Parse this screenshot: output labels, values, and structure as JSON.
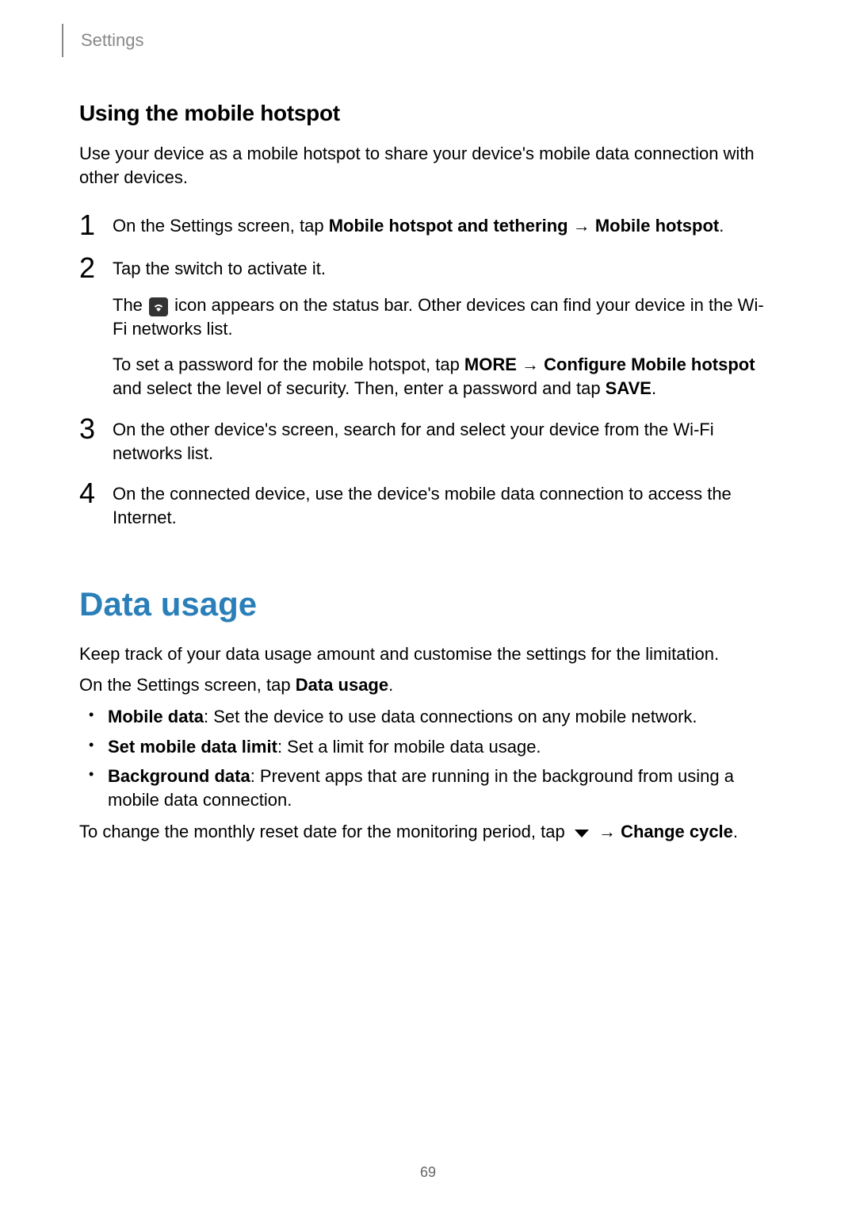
{
  "header": {
    "breadcrumb": "Settings"
  },
  "hotspot_section": {
    "subtitle": "Using the mobile hotspot",
    "intro": "Use your device as a mobile hotspot to share your device's mobile data connection with other devices.",
    "steps": {
      "s1": {
        "num": "1",
        "text_a": "On the Settings screen, tap ",
        "bold_a": "Mobile hotspot and tethering",
        "arrow": " → ",
        "bold_b": "Mobile hotspot",
        "text_end": "."
      },
      "s2": {
        "num": "2",
        "p1": "Tap the switch to activate it.",
        "p2_a": "The ",
        "p2_b": " icon appears on the status bar. Other devices can find your device in the Wi-Fi networks list.",
        "p3_a": "To set a password for the mobile hotspot, tap ",
        "p3_bold_a": "MORE",
        "p3_arr1": " → ",
        "p3_bold_b": "Configure Mobile hotspot",
        "p3_b": " and select the level of security. Then, enter a password and tap ",
        "p3_bold_c": "SAVE",
        "p3_end": "."
      },
      "s3": {
        "num": "3",
        "text": "On the other device's screen, search for and select your device from the Wi-Fi networks list."
      },
      "s4": {
        "num": "4",
        "text": "On the connected device, use the device's mobile data connection to access the Internet."
      }
    }
  },
  "data_usage_section": {
    "title": "Data usage",
    "intro": "Keep track of your data usage amount and customise the settings for the limitation.",
    "instruction_a": "On the Settings screen, tap ",
    "instruction_bold": "Data usage",
    "instruction_end": ".",
    "bullets": {
      "b1": {
        "bold": "Mobile data",
        "text": ": Set the device to use data connections on any mobile network."
      },
      "b2": {
        "bold": "Set mobile data limit",
        "text": ": Set a limit for mobile data usage."
      },
      "b3": {
        "bold": "Background data",
        "text": ": Prevent apps that are running in the background from using a mobile data connection."
      }
    },
    "cycle_a": "To change the monthly reset date for the monitoring period, tap ",
    "cycle_arrow": " → ",
    "cycle_bold": "Change cycle",
    "cycle_end": "."
  },
  "page_number": "69"
}
